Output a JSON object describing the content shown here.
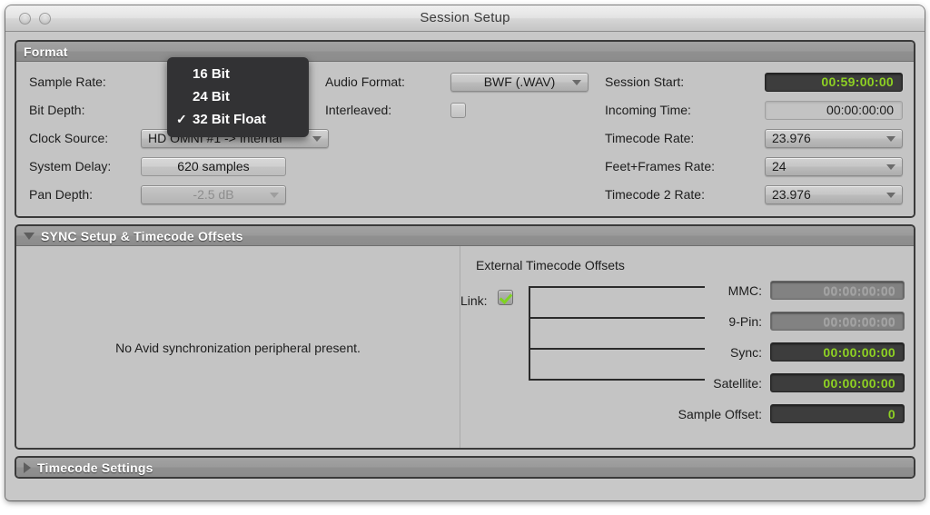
{
  "window": {
    "title": "Session Setup",
    "buttons": [
      "close-button",
      "minimize-button"
    ]
  },
  "format": {
    "header": "Format",
    "sample_rate_label": "Sample Rate:",
    "bit_depth_label": "Bit Depth:",
    "clock_source_label": "Clock Source:",
    "clock_source_value": "HD OMNI #1 -> Internal",
    "system_delay_label": "System Delay:",
    "system_delay_value": "620 samples",
    "pan_depth_label": "Pan Depth:",
    "pan_depth_value": "-2.5 dB",
    "audio_format_label": "Audio Format:",
    "audio_format_value": "BWF (.WAV)",
    "interleaved_label": "Interleaved:",
    "interleaved_checked": false,
    "session_start_label": "Session Start:",
    "session_start_value": "00:59:00:00",
    "incoming_time_label": "Incoming Time:",
    "incoming_time_value": "00:00:00:00",
    "timecode_rate_label": "Timecode Rate:",
    "timecode_rate_value": "23.976",
    "feet_frames_rate_label": "Feet+Frames Rate:",
    "feet_frames_rate_value": "24",
    "timecode2_rate_label": "Timecode 2 Rate:",
    "timecode2_rate_value": "23.976"
  },
  "bit_depth_menu": {
    "items": [
      {
        "label": "16 Bit",
        "checked": false,
        "check_glyph": ""
      },
      {
        "label": "24 Bit",
        "checked": false,
        "check_glyph": ""
      },
      {
        "label": "32 Bit Float",
        "checked": true,
        "check_glyph": "✓"
      }
    ]
  },
  "sync": {
    "header": "SYNC Setup & Timecode Offsets",
    "expanded": true,
    "disclosure_icon": "triangle-down-icon",
    "message": "No Avid synchronization peripheral present.",
    "external_title": "External Timecode Offsets",
    "link_label": "Link:",
    "link_checked": true,
    "offsets": [
      {
        "label": "MMC:",
        "value": "00:00:00:00",
        "enabled": false,
        "linked": true
      },
      {
        "label": "9-Pin:",
        "value": "00:00:00:00",
        "enabled": false,
        "linked": true
      },
      {
        "label": "Sync:",
        "value": "00:00:00:00",
        "enabled": true,
        "linked": true
      },
      {
        "label": "Satellite:",
        "value": "00:00:00:00",
        "enabled": true,
        "linked": true
      },
      {
        "label": "Sample Offset:",
        "value": "0",
        "enabled": true,
        "linked": false
      }
    ]
  },
  "timecode_settings": {
    "header": "Timecode Settings",
    "expanded": false,
    "disclosure_icon": "triangle-right-icon"
  },
  "colors": {
    "timecode_green": "#8ed123",
    "timecode_bg": "#3d3d3d",
    "panel_bg": "#c4c4c4",
    "header_gray": "#949494",
    "menu_bg": "#323234",
    "check_green": "#7ed321"
  }
}
